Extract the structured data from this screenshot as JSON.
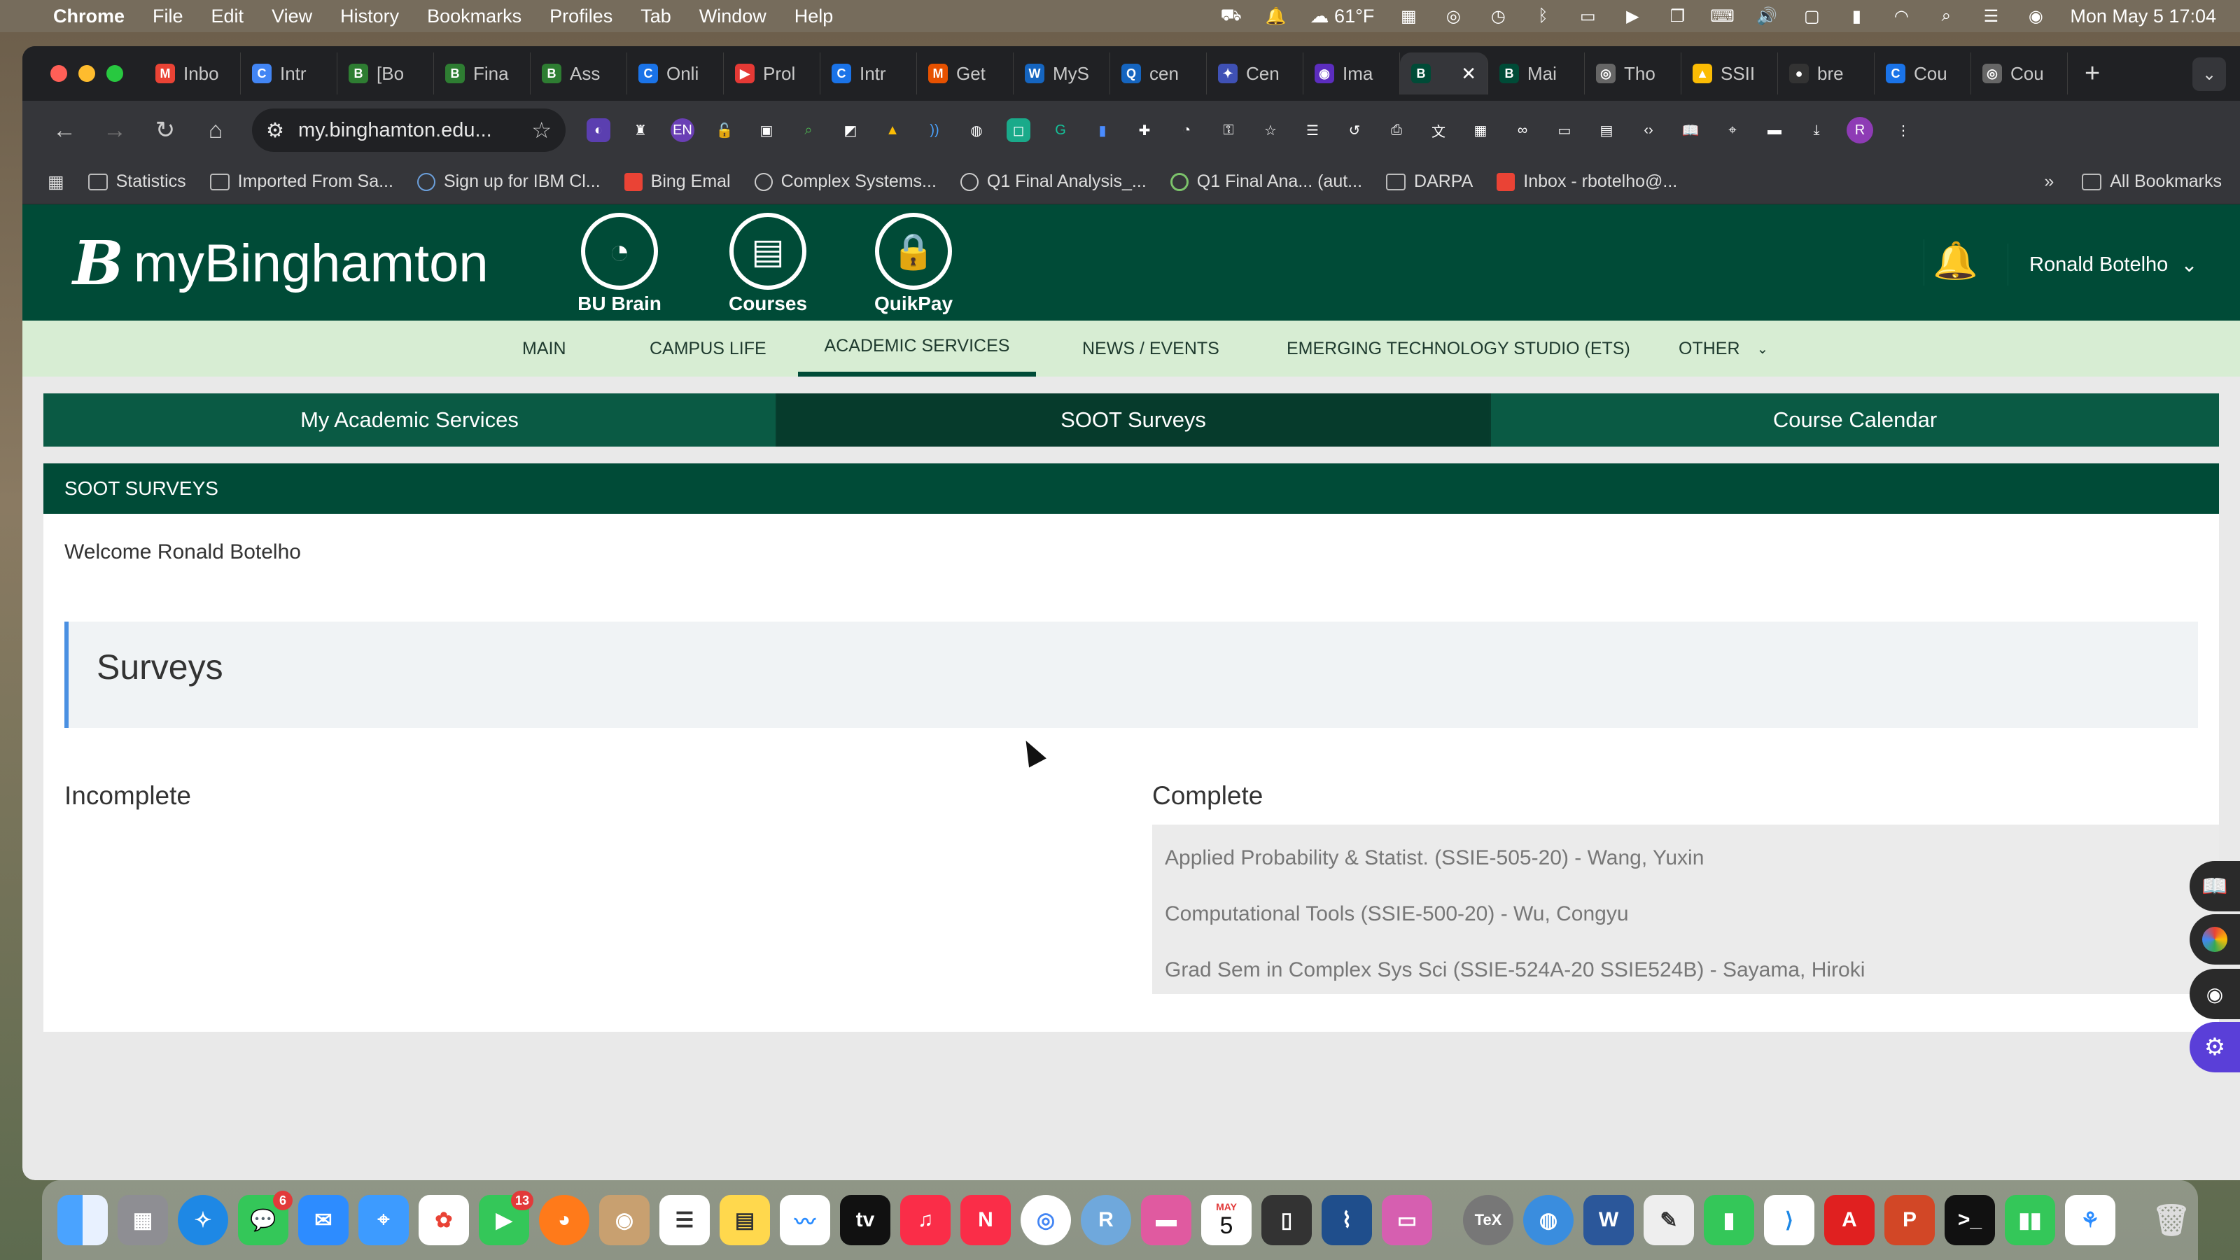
{
  "menubar": {
    "app": "Chrome",
    "items": [
      "File",
      "Edit",
      "View",
      "History",
      "Bookmarks",
      "Profiles",
      "Tab",
      "Window",
      "Help"
    ],
    "weather": "61°F",
    "datetime": "Mon May 5  17:04"
  },
  "browser": {
    "tabs": [
      {
        "label": "Inbo",
        "color": "#ea4335",
        "glyph": "M"
      },
      {
        "label": "Intr",
        "color": "#4285f4",
        "glyph": "C"
      },
      {
        "label": "[Bo",
        "color": "#2e7d32",
        "glyph": "B"
      },
      {
        "label": "Fina",
        "color": "#2e7d32",
        "glyph": "B"
      },
      {
        "label": "Ass",
        "color": "#2e7d32",
        "glyph": "B"
      },
      {
        "label": "Onli",
        "color": "#1a73e8",
        "glyph": "C"
      },
      {
        "label": "Prol",
        "color": "#e53935",
        "glyph": "▶"
      },
      {
        "label": "Intr",
        "color": "#1a73e8",
        "glyph": "C"
      },
      {
        "label": "Get",
        "color": "#e65100",
        "glyph": "M"
      },
      {
        "label": "MyS",
        "color": "#1565c0",
        "glyph": "W"
      },
      {
        "label": "cen",
        "color": "#1565c0",
        "glyph": "Q"
      },
      {
        "label": "Cen",
        "color": "#3f51b5",
        "glyph": "✦"
      },
      {
        "label": "Ima",
        "color": "#5c2dbf",
        "glyph": "◉"
      },
      {
        "label": "Mai",
        "color": "#004b37",
        "glyph": "B"
      },
      {
        "label": "Tho",
        "color": "#666666",
        "glyph": "◎"
      },
      {
        "label": "SSII",
        "color": "#fbbc04",
        "glyph": "▲"
      },
      {
        "label": "bre",
        "color": "#333333",
        "glyph": "●"
      },
      {
        "label": "Cou",
        "color": "#1a73e8",
        "glyph": "C"
      },
      {
        "label": "Cou",
        "color": "#666666",
        "glyph": "◎"
      }
    ],
    "active_tab_glyph": "B",
    "url": "my.binghamton.edu...",
    "bookmarks": [
      "Statistics",
      "Imported From Sa...",
      "Sign up for IBM Cl...",
      "Bing Emal",
      "Complex Systems...",
      "Q1 Final Analysis_...",
      "Q1 Final Ana... (aut...",
      "DARPA",
      "Inbox - rbotelho@..."
    ],
    "all_bookmarks": "All Bookmarks",
    "profile_initial": "R"
  },
  "site": {
    "logo_letter": "B",
    "logo_text": "myBinghamton",
    "header_buttons": [
      {
        "label": "BU Brain",
        "icon": "brain-icon"
      },
      {
        "label": "Courses",
        "icon": "book-icon"
      },
      {
        "label": "QuikPay",
        "icon": "lock-icon"
      }
    ],
    "user_name": "Ronald Botelho",
    "nav": [
      "MAIN",
      "CAMPUS LIFE",
      "ACADEMIC SERVICES",
      "NEWS / EVENTS",
      "EMERGING TECHNOLOGY STUDIO (ETS)",
      "OTHER"
    ],
    "active_nav": "ACADEMIC SERVICES",
    "subtabs": [
      "My Academic Services",
      "SOOT Surveys",
      "Course Calendar"
    ],
    "active_subtab": "SOOT Surveys",
    "panel_title": "SOOT SURVEYS",
    "welcome": "Welcome Ronald Botelho",
    "surveys_heading": "Surveys",
    "incomplete_label": "Incomplete",
    "complete_label": "Complete",
    "complete_items": [
      "Applied Probability & Statist. (SSIE-505-20) - Wang, Yuxin",
      "Computational Tools (SSIE-500-20) - Wu, Congyu",
      "Grad Sem in Complex Sys Sci (SSIE-524A-20 SSIE524B) - Sayama, Hiroki"
    ]
  },
  "dock": {
    "messages_badge": "6",
    "facetime_badge": "13",
    "calendar_month": "MAY",
    "calendar_day": "5"
  },
  "colors": {
    "brand_green": "#004b37",
    "nav_bg": "#d7edd3",
    "subtab_green": "#0a5a44",
    "subtab_active": "#063b2c",
    "accent_blue": "#4a90e2"
  }
}
